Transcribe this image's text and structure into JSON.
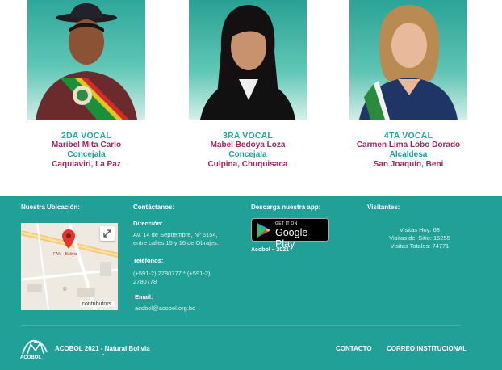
{
  "members": [
    {
      "role": "2DA VOCAL",
      "name": "Maribel Mita Carlo",
      "position": "Concejala",
      "place": "Caquiaviri, La Paz"
    },
    {
      "role": "3RA VOCAL",
      "name": "Mabel Bedoya Loza",
      "position": "Concejala",
      "place": "Culpina, Chuquisaca"
    },
    {
      "role": "4TA VOCAL",
      "name": "Carmen Lima Lobo Dorado",
      "position": "Alcaldesa",
      "place": "San Joaquín, Beni"
    }
  ],
  "footer": {
    "location_heading": "Nuestra Ubicación:",
    "map_label": "FAM - Bolivia",
    "map_attribution": "contributors.",
    "map_copyright": "©",
    "contact_heading": "Contáctanos:",
    "address_label": "Dirección:",
    "address_line1": "Av. 14 de Septiembre, Nº 6154,",
    "address_line2": "entre calles 15 y 16 de Obrajes.",
    "phones_label": "Teléfonos:",
    "phones_line1": "(+591-2) 2780777 * (+591-2)",
    "phones_line2": "2780778",
    "email_label": "Email:",
    "email_value": "acobol@acobol.org.bo",
    "download_heading": "Descarga nuestra app:",
    "store_small": "GET IT ON",
    "store_big": "Google Play",
    "app_caption": "Acobol – 2021",
    "visitors_heading": "Visitantes:",
    "visits_today": "Visitas Hoy: 68",
    "visits_site": "Visitas del Sitio: 15255",
    "visits_total": "Visitas Totales: 74771",
    "logo_text": "ACOBOL",
    "copyright": "ACOBOL 2021 - Natural Bolivia",
    "dot": "•",
    "link_contact": "CONTACTO",
    "link_mail": "CORREO INSTITUCIONAL"
  },
  "colors": {
    "footer_bg": "#20a096",
    "role": "#21a6a0",
    "name": "#a3245f",
    "teal_text": "#1e9c96"
  },
  "icons": [
    "map-pin-icon",
    "fullscreen-icon",
    "google-play-icon",
    "acobol-logo"
  ]
}
